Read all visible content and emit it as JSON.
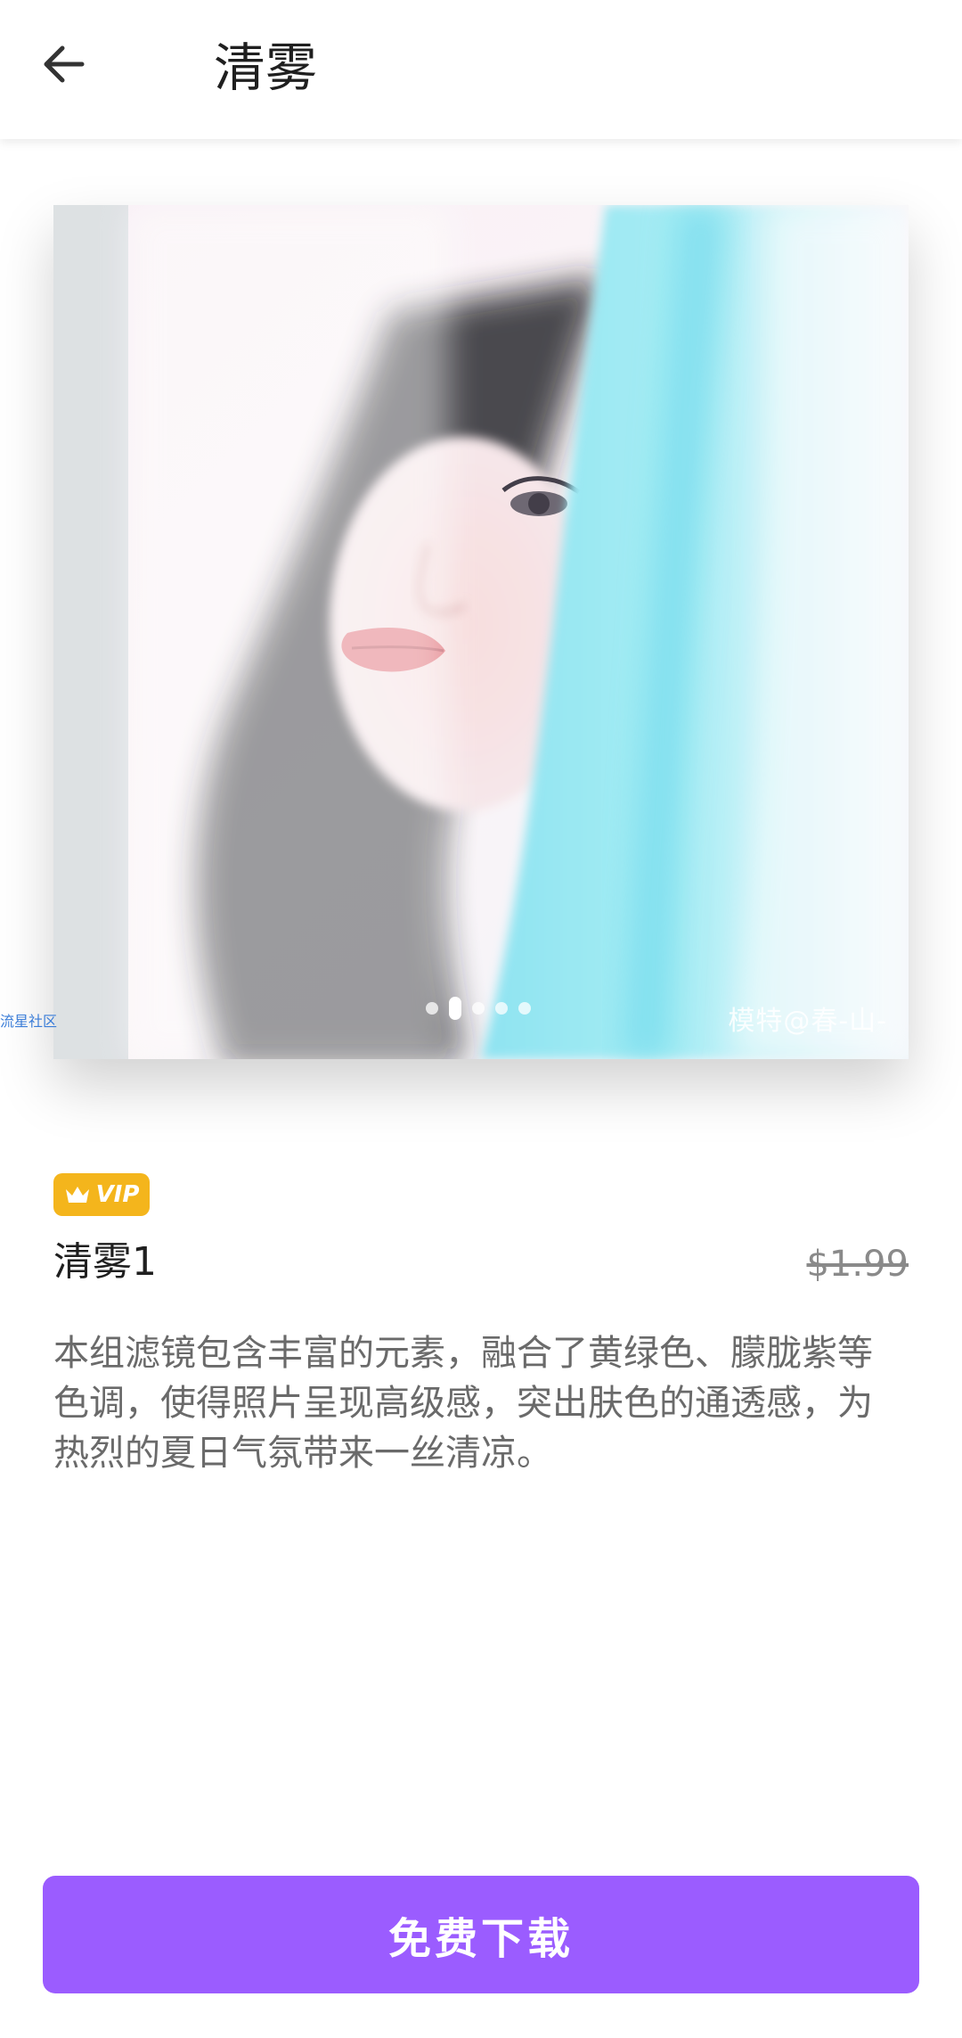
{
  "header": {
    "title": "清雾"
  },
  "preview": {
    "community_tag": "流星社区",
    "watermark": "模特@春-山-",
    "slides_count": 5,
    "active_slide": 2
  },
  "product": {
    "badge": "VIP",
    "name": "清雾1",
    "price": "$1.99",
    "description": "本组滤镜包含丰富的元素，融合了黄绿色、朦胧紫等色调，使得照片呈现高级感，突出肤色的通透感，为热烈的夏日气氛带来一丝清凉。"
  },
  "actions": {
    "download_label": "免费下载"
  },
  "colors": {
    "accent": "#9b5cff",
    "vip": "#f4b51c"
  }
}
